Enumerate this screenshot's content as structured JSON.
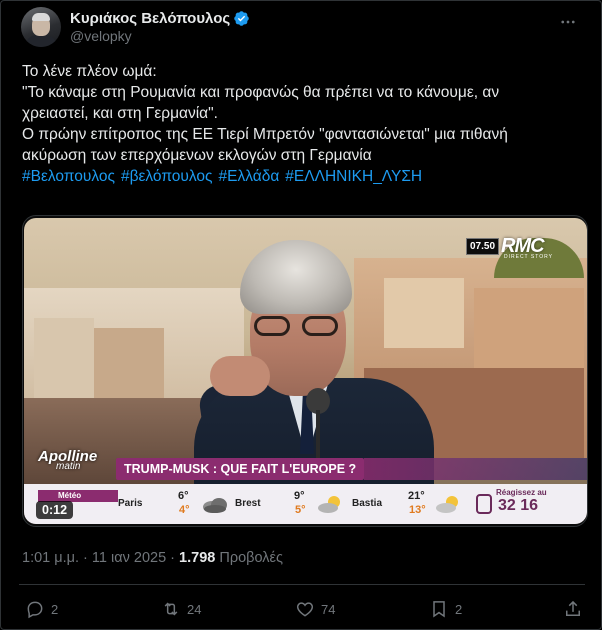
{
  "author": {
    "display_name": "Κυριάκος Βελόπουλος",
    "handle": "@velopky",
    "verified_icon": "verified-badge-icon",
    "verified_color": "#1d9bf0"
  },
  "tweet": {
    "lines": [
      "Το λένε πλέον ωμά:",
      "\"Το κάναμε στη Ρουμανία και προφανώς θα πρέπει να το κάνουμε, αν",
      "χρειαστεί, και στη Γερμανία\".",
      "Ο πρώην επίτροπος της ΕΕ Τιερί Μπρετόν \"φαντασιώνεται\" μια πιθανή",
      "ακύρωση των επερχόμενων εκλογών στη Γερμανία"
    ],
    "hashtags": [
      "#Βελοπουλος",
      "#βελόπουλος",
      "#Ελλάδα",
      "#ΕΛΛΗΝΙΚΗ_ΛΥΣΗ"
    ],
    "hashtag_color": "#1d9bf0"
  },
  "video": {
    "timecode": "0:12",
    "channel_time": "07.50",
    "channel_name": "RMC",
    "channel_sub": "DIRECT STORY",
    "show_name": "Apolline",
    "show_sub": "matin",
    "banner": "TRUMP-MUSK : QUE FAIT L'EUROPE ?",
    "meteo_label": "Météo",
    "weather": [
      {
        "city": "Paris",
        "high": "6°",
        "low": "4°",
        "icon": "cloud-icon"
      },
      {
        "city": "Brest",
        "high": "9°",
        "low": "5°",
        "icon": "sun-cloud-icon"
      },
      {
        "city": "Bastia",
        "high": "21°",
        "low": "13°",
        "icon": "sun-cloud-icon"
      }
    ],
    "react_label": "Réagissez au",
    "react_number": "32 16"
  },
  "meta": {
    "time": "1:01 μ.μ.",
    "separator": " · ",
    "date": "11 ιαν 2025",
    "views_count": "1.798",
    "views_label": " Προβολές"
  },
  "actions": {
    "replies": "2",
    "retweets": "24",
    "likes": "74",
    "bookmarks": "2"
  },
  "colors": {
    "background": "#000000",
    "text": "#e7e9ea",
    "muted": "#71767b",
    "accent": "#1d9bf0",
    "banner": "#8b2c6f"
  }
}
